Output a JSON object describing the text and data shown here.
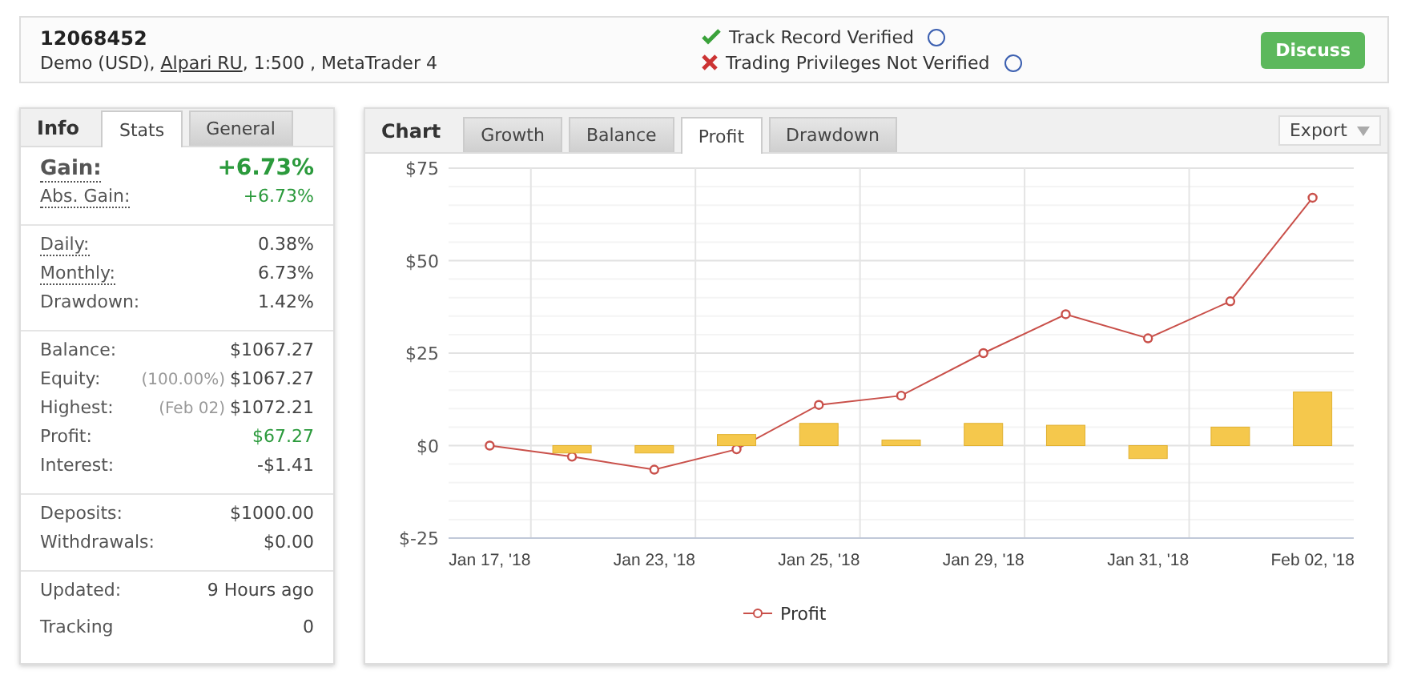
{
  "account": {
    "number": "12068452",
    "details_before": "Demo (USD), ",
    "broker_link": "Alpari RU",
    "details_after": ", 1:500 , MetaTrader 4"
  },
  "verification": [
    {
      "text": "Track Record Verified",
      "verified": true
    },
    {
      "text": "Trading Privileges Not Verified",
      "verified": false
    }
  ],
  "discuss_button": "Discuss",
  "info_panel": {
    "title": "Info",
    "tabs": [
      {
        "label": "Stats",
        "selected": true
      },
      {
        "label": "General",
        "selected": false
      }
    ],
    "groups": [
      [
        {
          "kind": "headline",
          "label": "Gain:",
          "value": "+6.73%",
          "dotted": true,
          "positive": true
        },
        {
          "kind": "row",
          "label": "Abs. Gain:",
          "value": "+6.73%",
          "dotted": true,
          "positive": true
        }
      ],
      [
        {
          "kind": "row",
          "label": "Daily:",
          "value": "0.38%",
          "dotted": true,
          "positive": false
        },
        {
          "kind": "row",
          "label": "Monthly:",
          "value": "6.73%",
          "dotted": true,
          "positive": false
        },
        {
          "kind": "row",
          "label": "Drawdown:",
          "value": "1.42%",
          "dotted": false,
          "positive": false
        }
      ],
      [
        {
          "kind": "row",
          "label": "Balance:",
          "value": "$1067.27",
          "dotted": false,
          "positive": false
        },
        {
          "kind": "row",
          "label": "Equity:",
          "note": "(100.00%)",
          "value": "$1067.27",
          "dotted": false,
          "positive": false
        },
        {
          "kind": "row",
          "label": "Highest:",
          "note": "(Feb 02)",
          "value": "$1072.21",
          "dotted": false,
          "positive": false
        },
        {
          "kind": "row",
          "label": "Profit:",
          "value": "$67.27",
          "dotted": false,
          "positive": true
        },
        {
          "kind": "row",
          "label": "Interest:",
          "value": "-$1.41",
          "dotted": false,
          "positive": false
        }
      ],
      [
        {
          "kind": "row",
          "label": "Deposits:",
          "value": "$1000.00",
          "dotted": false,
          "positive": false
        },
        {
          "kind": "row",
          "label": "Withdrawals:",
          "value": "$0.00",
          "dotted": false,
          "positive": false
        }
      ],
      [
        {
          "kind": "tall",
          "label": "Updated:",
          "value": "9 Hours ago",
          "dotted": false,
          "positive": false
        },
        {
          "kind": "tall",
          "label": "Tracking",
          "value": "0",
          "dotted": false,
          "positive": false
        }
      ]
    ]
  },
  "chart_panel": {
    "title": "Chart",
    "tabs": [
      {
        "label": "Growth",
        "selected": false
      },
      {
        "label": "Balance",
        "selected": false
      },
      {
        "label": "Profit",
        "selected": true
      },
      {
        "label": "Drawdown",
        "selected": false
      }
    ],
    "export_button": "Export",
    "chart_data": {
      "type": "line",
      "grid": true,
      "categories": [
        "Jan 17, '18",
        null,
        "Jan 23, '18",
        null,
        "Jan 25, '18",
        null,
        "Jan 29, '18",
        null,
        "Jan 31, '18",
        null,
        "Feb 02, '18"
      ],
      "ylim": [
        -25,
        75
      ],
      "yticks": [
        {
          "value": -25,
          "label": "$-25"
        },
        {
          "value": 0,
          "label": "$0"
        },
        {
          "value": 25,
          "label": "$25"
        },
        {
          "value": 50,
          "label": "$50"
        },
        {
          "value": 75,
          "label": "$75"
        }
      ],
      "series": [
        {
          "name": "Profit",
          "color": "#c9504a",
          "marker": "circle",
          "values": [
            0,
            -3,
            -6.5,
            -1,
            11,
            13.5,
            25,
            35.5,
            29,
            39,
            67
          ]
        },
        {
          "color": "#f5c84c",
          "type": "bar",
          "values": [
            null,
            -2,
            -2,
            3,
            6,
            1.5,
            6,
            5.5,
            -3.5,
            5,
            14.5
          ]
        }
      ]
    }
  }
}
